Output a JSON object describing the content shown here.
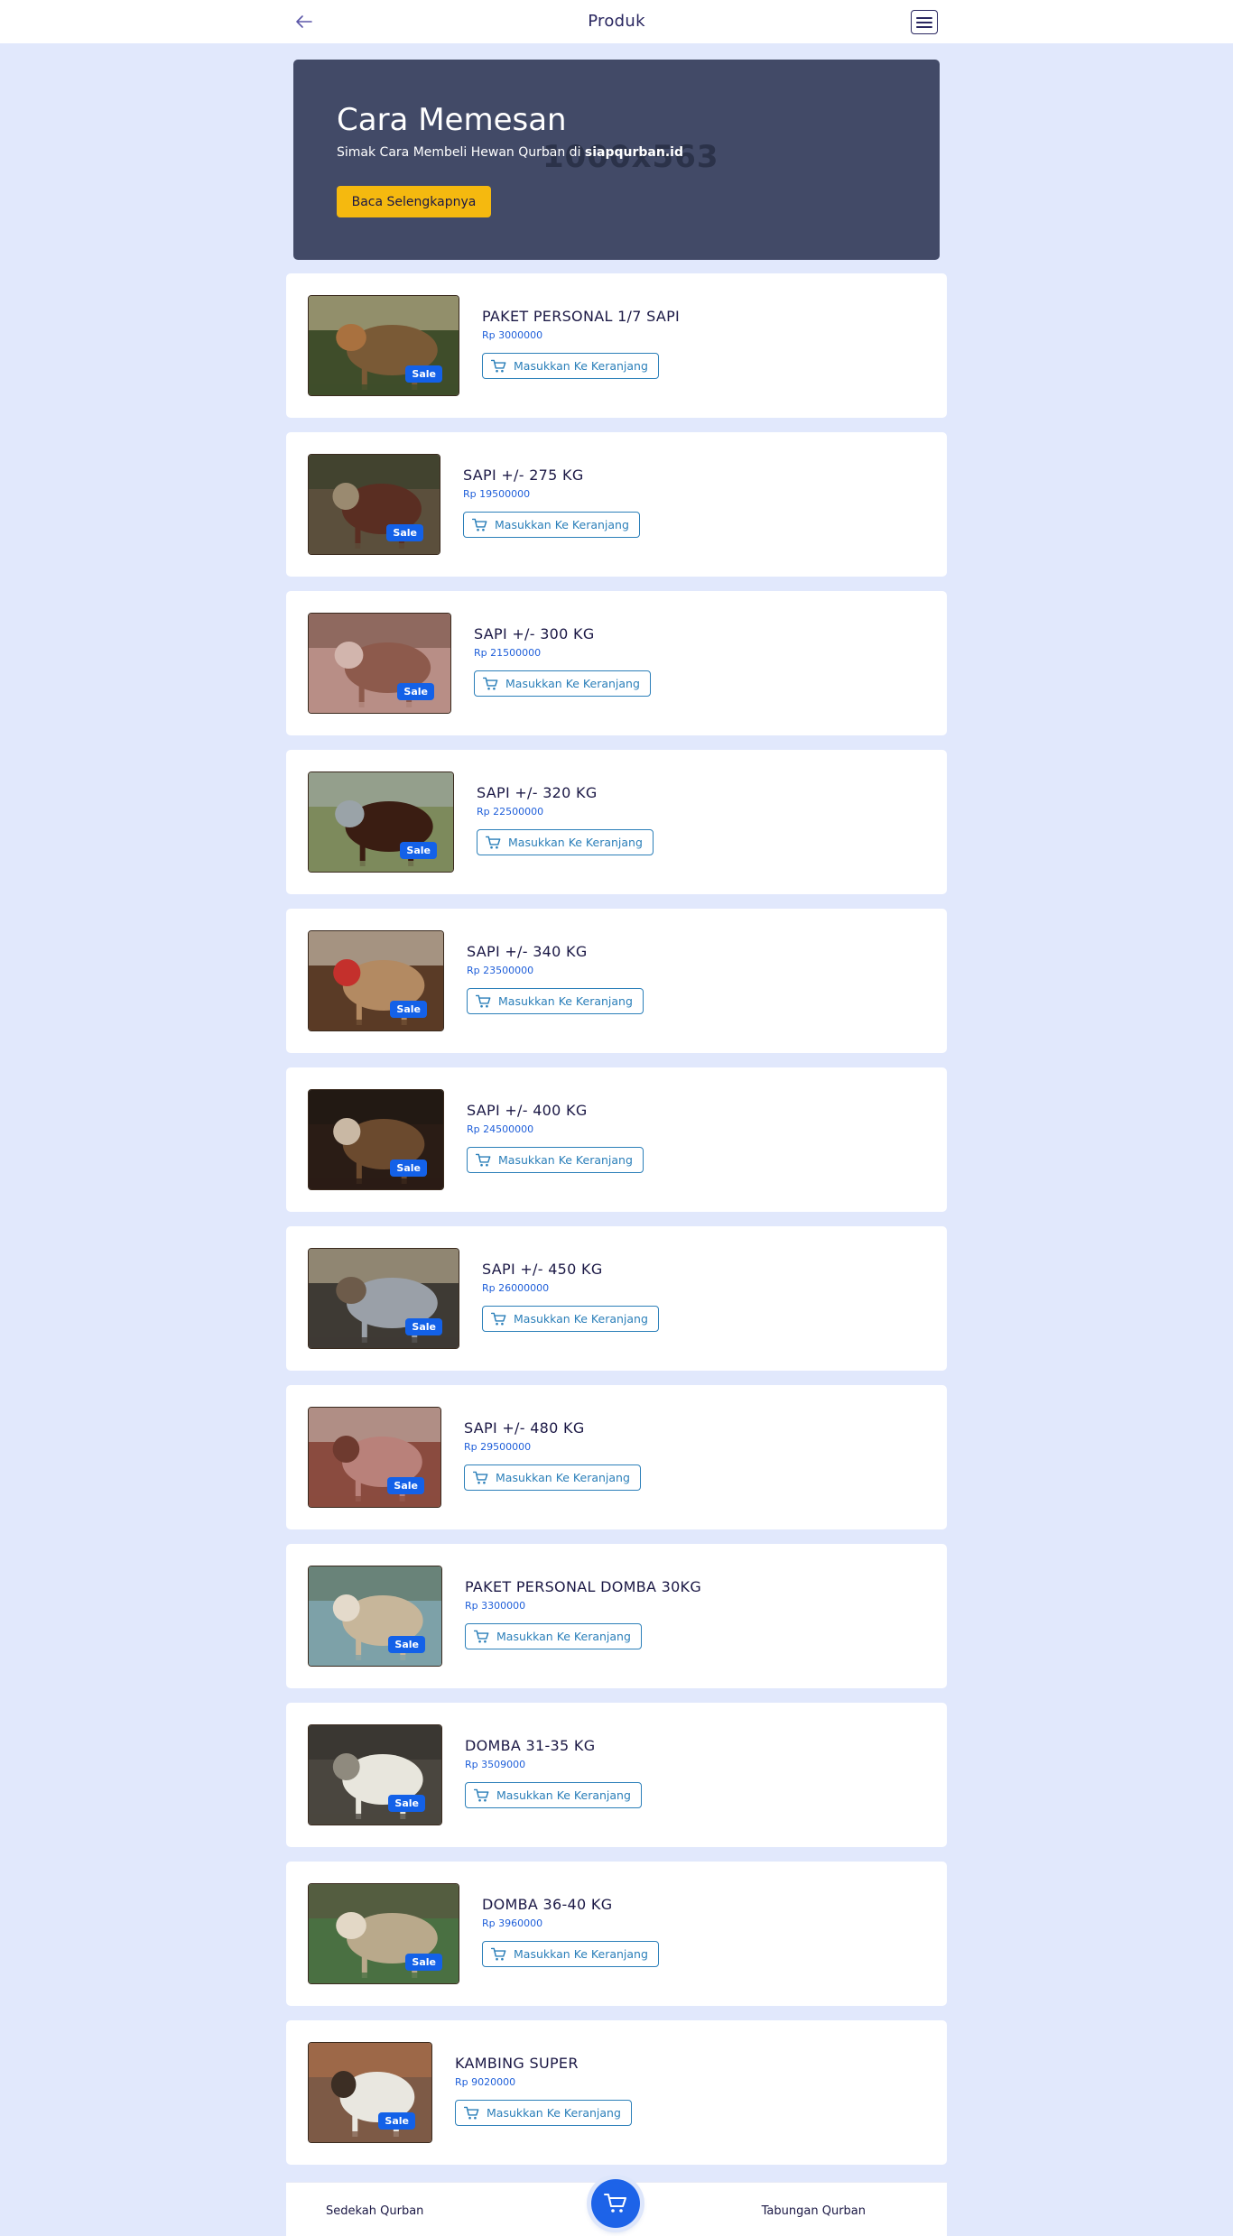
{
  "header": {
    "title": "Produk",
    "back_icon": "arrow-left-icon",
    "menu_icon": "hamburger-icon"
  },
  "banner": {
    "watermark": "1000x563",
    "title": "Cara Memesan",
    "subtitle_prefix": "Simak Cara Membeli Hewan Qurban di ",
    "subtitle_brand": "siapqurban.id",
    "button_label": "Baca Selengkapnya"
  },
  "products": [
    {
      "name": "PAKET PERSONAL 1/7 SAPI",
      "price": "Rp 3000000",
      "badge": "Sale",
      "cart_label": "Masukkan Ke Keranjang"
    },
    {
      "name": "SAPI +/- 275 KG",
      "price": "Rp 19500000",
      "badge": "Sale",
      "cart_label": "Masukkan Ke Keranjang"
    },
    {
      "name": "SAPI +/- 300 KG",
      "price": "Rp 21500000",
      "badge": "Sale",
      "cart_label": "Masukkan Ke Keranjang"
    },
    {
      "name": "SAPI +/- 320 KG",
      "price": "Rp 22500000",
      "badge": "Sale",
      "cart_label": "Masukkan Ke Keranjang"
    },
    {
      "name": "SAPI +/- 340 KG",
      "price": "Rp 23500000",
      "badge": "Sale",
      "cart_label": "Masukkan Ke Keranjang"
    },
    {
      "name": "SAPI +/- 400 KG",
      "price": "Rp 24500000",
      "badge": "Sale",
      "cart_label": "Masukkan Ke Keranjang"
    },
    {
      "name": "SAPI +/- 450 KG",
      "price": "Rp 26000000",
      "badge": "Sale",
      "cart_label": "Masukkan Ke Keranjang"
    },
    {
      "name": "SAPI +/- 480 KG",
      "price": "Rp 29500000",
      "badge": "Sale",
      "cart_label": "Masukkan Ke Keranjang"
    },
    {
      "name": "PAKET PERSONAL DOMBA 30KG",
      "price": "Rp 3300000",
      "badge": "Sale",
      "cart_label": "Masukkan Ke Keranjang"
    },
    {
      "name": "DOMBA 31-35 KG",
      "price": "Rp 3509000",
      "badge": "Sale",
      "cart_label": "Masukkan Ke Keranjang"
    },
    {
      "name": "DOMBA 36-40 KG",
      "price": "Rp 3960000",
      "badge": "Sale",
      "cart_label": "Masukkan Ke Keranjang"
    },
    {
      "name": "KAMBING SUPER",
      "price": "Rp 9020000",
      "badge": "Sale",
      "cart_label": "Masukkan Ke Keranjang"
    }
  ],
  "bottom_nav": {
    "left": "Sedekah Qurban",
    "right": "Tabungan Qurban",
    "center_icon": "cart-icon"
  },
  "colors": {
    "page_bg": "#e1e8fc",
    "banner_bg": "#424a67",
    "button_yellow": "#f5b90f",
    "accent_blue": "#1d63e8",
    "sale_badge": "#1361e8",
    "cart_outline": "#2b7fb9"
  }
}
